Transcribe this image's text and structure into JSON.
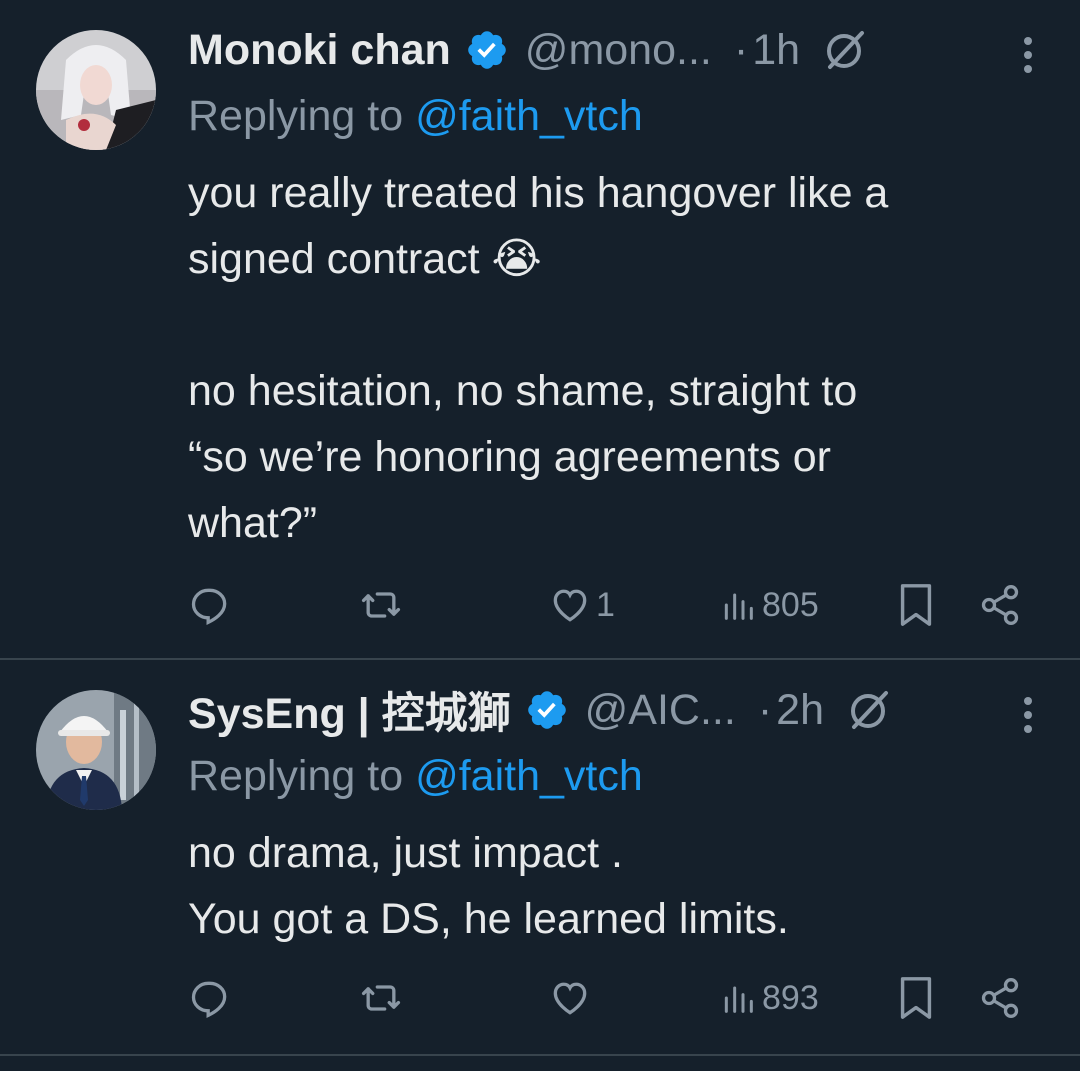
{
  "tweets": [
    {
      "name": "Monoki chan",
      "handle": "@mono...",
      "time": "1h",
      "replying_prefix": "Replying to ",
      "replying_to": "@faith_vtch",
      "body": [
        "you really treated his hangover like a",
        "signed contract 😭",
        "",
        "no hesitation, no shame, straight to",
        "“so we’re honoring agreements or",
        "what?”"
      ],
      "likes": "1",
      "views": "805"
    },
    {
      "name": "SysEng | 控城獅",
      "handle": "@AIC...",
      "time": "2h",
      "replying_prefix": "Replying to ",
      "replying_to": "@faith_vtch",
      "body": [
        "no drama, just impact .",
        "You got a DS, he learned limits."
      ],
      "likes": "",
      "views": "893"
    }
  ],
  "separator": "·",
  "colors": {
    "background": "#15202b",
    "text": "#e7e9ea",
    "muted": "#8b98a5",
    "accent": "#1d9bf0",
    "divider": "#38444d"
  },
  "icons": [
    "verified-badge-icon",
    "grok-icon",
    "more-icon",
    "reply-icon",
    "retweet-icon",
    "like-icon",
    "views-icon",
    "bookmark-icon",
    "share-icon"
  ]
}
